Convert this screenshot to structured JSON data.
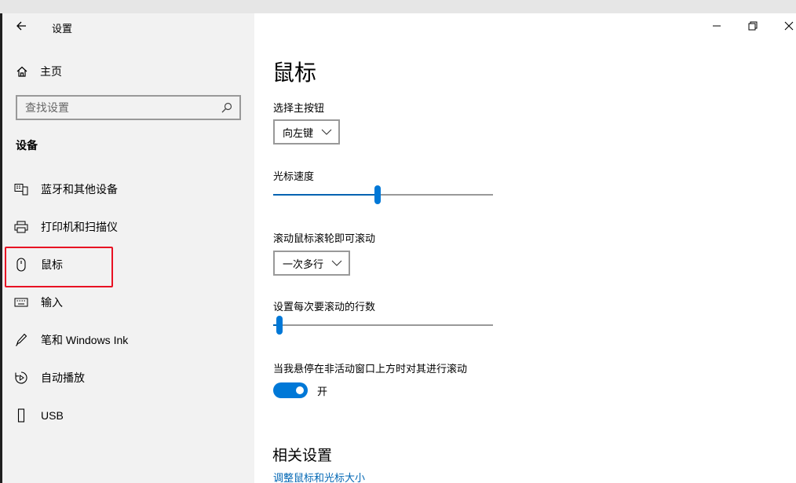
{
  "window": {
    "app_title": "设置"
  },
  "sidebar": {
    "home_label": "主页",
    "search_placeholder": "查找设置",
    "section_title": "设备",
    "items": [
      {
        "label": "蓝牙和其他设备",
        "icon": "bluetooth-devices-icon"
      },
      {
        "label": "打印机和扫描仪",
        "icon": "printer-icon"
      },
      {
        "label": "鼠标",
        "icon": "mouse-icon",
        "selected": true
      },
      {
        "label": "输入",
        "icon": "keyboard-icon"
      },
      {
        "label": "笔和 Windows Ink",
        "icon": "pen-icon"
      },
      {
        "label": "自动播放",
        "icon": "autoplay-icon"
      },
      {
        "label": "USB",
        "icon": "usb-icon"
      }
    ]
  },
  "main": {
    "title": "鼠标",
    "primary_button": {
      "label": "选择主按钮",
      "value": "向左键"
    },
    "cursor_speed": {
      "label": "光标速度",
      "level": 0.475
    },
    "scroll_mode": {
      "label": "滚动鼠标滚轮即可滚动",
      "value": "一次多行"
    },
    "scroll_lines": {
      "label": "设置每次要滚动的行数",
      "level": 0.03
    },
    "inactive_scroll": {
      "label": "当我悬停在非活动窗口上方时对其进行滚动",
      "state": "开",
      "on": true
    },
    "related": {
      "title": "相关设置",
      "link": "调整鼠标和光标大小"
    }
  },
  "colors": {
    "accent": "#0078d7",
    "highlight_box": "#e81123",
    "link": "#0066b4",
    "sidebar_bg": "#f2f2f2"
  }
}
